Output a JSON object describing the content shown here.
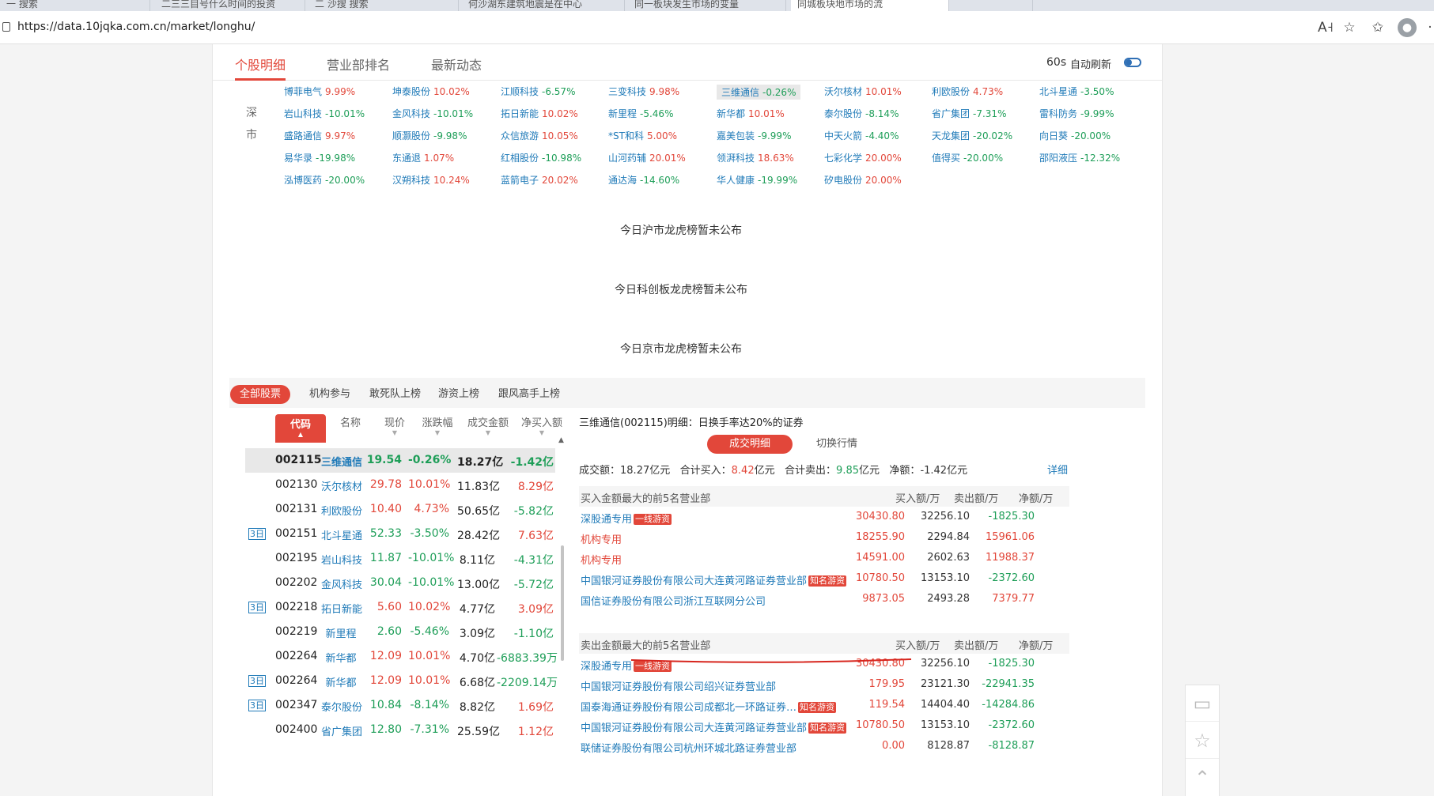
{
  "browser": {
    "tabs": [
      "一 搜索",
      "二三三目号什么时间的投资",
      "二 沙搜 搜索",
      "何沙湖东建筑地震是在中心",
      "同一板块发生市场的变量",
      "同城板块地市场的流",
      ""
    ],
    "url": "https://data.10jqka.com.cn/market/longhu/",
    "icons": [
      "read-aloud-icon",
      "favorite-icon",
      "collections-icon",
      "profile-icon",
      "more-icon"
    ]
  },
  "nav": {
    "tabs": [
      "个股明细",
      "营业部排名",
      "最新动态"
    ],
    "refresh_seconds": "60s",
    "refresh_label": "自动刷新"
  },
  "sz_market": {
    "label_top": "深",
    "label_bottom": "市",
    "stocks": [
      [
        "博菲电气",
        "9.99%",
        "up"
      ],
      [
        "坤泰股份",
        "10.02%",
        "up"
      ],
      [
        "江顺科技",
        "-6.57%",
        "down"
      ],
      [
        "三变科技",
        "9.98%",
        "up"
      ],
      [
        "三维通信",
        "-0.26%",
        "down"
      ],
      [
        "沃尔核材",
        "10.01%",
        "up"
      ],
      [
        "利欧股份",
        "4.73%",
        "up"
      ],
      [
        "北斗星通",
        "-3.50%",
        "down"
      ],
      [
        "岩山科技",
        "-10.01%",
        "down"
      ],
      [
        "金风科技",
        "-10.01%",
        "down"
      ],
      [
        "拓日新能",
        "10.02%",
        "up"
      ],
      [
        "新里程",
        "-5.46%",
        "down"
      ],
      [
        "新华都",
        "10.01%",
        "up"
      ],
      [
        "泰尔股份",
        "-8.14%",
        "down"
      ],
      [
        "省广集团",
        "-7.31%",
        "down"
      ],
      [
        "雷科防务",
        "-9.99%",
        "down"
      ],
      [
        "盛路通信",
        "9.97%",
        "up"
      ],
      [
        "顺灏股份",
        "-9.98%",
        "down"
      ],
      [
        "众信旅游",
        "10.05%",
        "up"
      ],
      [
        "*ST和科",
        "5.00%",
        "up"
      ],
      [
        "嘉美包装",
        "-9.99%",
        "down"
      ],
      [
        "中天火箭",
        "-4.40%",
        "down"
      ],
      [
        "天龙集团",
        "-20.02%",
        "down"
      ],
      [
        "向日葵",
        "-20.00%",
        "down"
      ],
      [
        "易华录",
        "-19.98%",
        "down"
      ],
      [
        "东通退",
        "1.07%",
        "up"
      ],
      [
        "红相股份",
        "-10.98%",
        "down"
      ],
      [
        "山河药辅",
        "20.01%",
        "up"
      ],
      [
        "领湃科技",
        "18.63%",
        "up"
      ],
      [
        "七彩化学",
        "20.00%",
        "up"
      ],
      [
        "值得买",
        "-20.00%",
        "down"
      ],
      [
        "邵阳液压",
        "-12.32%",
        "down"
      ],
      [
        "泓博医药",
        "-20.00%",
        "down"
      ],
      [
        "汉朔科技",
        "10.24%",
        "up"
      ],
      [
        "蓝箭电子",
        "20.02%",
        "up"
      ],
      [
        "通达海",
        "-14.60%",
        "down"
      ],
      [
        "华人健康",
        "-19.99%",
        "down"
      ],
      [
        "矽电股份",
        "20.00%",
        "up"
      ]
    ]
  },
  "notices": {
    "sh": "今日沪市龙虎榜暂未公布",
    "kcb": "今日科创板龙虎榜暂未公布",
    "bj": "今日京市龙虎榜暂未公布"
  },
  "filter_tabs": [
    "全部股票",
    "机构参与",
    "敢死队上榜",
    "游资上榜",
    "跟风高手上榜"
  ],
  "list": {
    "headers": [
      "代码",
      "名称",
      "现价",
      "涨跌幅",
      "成交金额",
      "净买入额"
    ],
    "rows": [
      {
        "badge": "",
        "code": "002115",
        "name": "三维通信",
        "price": "19.54",
        "chg": "-0.26%",
        "amt": "18.27亿",
        "net": "-1.42亿",
        "dir": "down",
        "ndir": "down"
      },
      {
        "badge": "",
        "code": "002130",
        "name": "沃尔核材",
        "price": "29.78",
        "chg": "10.01%",
        "amt": "11.83亿",
        "net": "8.29亿",
        "dir": "up",
        "ndir": "up"
      },
      {
        "badge": "",
        "code": "002131",
        "name": "利欧股份",
        "price": "10.40",
        "chg": "4.73%",
        "amt": "50.65亿",
        "net": "-5.82亿",
        "dir": "up",
        "ndir": "down"
      },
      {
        "badge": "3日",
        "code": "002151",
        "name": "北斗星通",
        "price": "52.33",
        "chg": "-3.50%",
        "amt": "28.42亿",
        "net": "7.63亿",
        "dir": "down",
        "ndir": "up"
      },
      {
        "badge": "",
        "code": "002195",
        "name": "岩山科技",
        "price": "11.87",
        "chg": "-10.01%",
        "amt": "8.11亿",
        "net": "-4.31亿",
        "dir": "down",
        "ndir": "down"
      },
      {
        "badge": "",
        "code": "002202",
        "name": "金风科技",
        "price": "30.04",
        "chg": "-10.01%",
        "amt": "13.00亿",
        "net": "-5.72亿",
        "dir": "down",
        "ndir": "down"
      },
      {
        "badge": "3日",
        "code": "002218",
        "name": "拓日新能",
        "price": "5.60",
        "chg": "10.02%",
        "amt": "4.77亿",
        "net": "3.09亿",
        "dir": "up",
        "ndir": "up"
      },
      {
        "badge": "",
        "code": "002219",
        "name": "新里程",
        "price": "2.60",
        "chg": "-5.46%",
        "amt": "3.09亿",
        "net": "-1.10亿",
        "dir": "down",
        "ndir": "down"
      },
      {
        "badge": "",
        "code": "002264",
        "name": "新华都",
        "price": "12.09",
        "chg": "10.01%",
        "amt": "4.70亿",
        "net": "-6883.39万",
        "dir": "up",
        "ndir": "down"
      },
      {
        "badge": "3日",
        "code": "002264",
        "name": "新华都",
        "price": "12.09",
        "chg": "10.01%",
        "amt": "6.68亿",
        "net": "-2209.14万",
        "dir": "up",
        "ndir": "down"
      },
      {
        "badge": "3日",
        "code": "002347",
        "name": "泰尔股份",
        "price": "10.84",
        "chg": "-8.14%",
        "amt": "8.82亿",
        "net": "1.69亿",
        "dir": "down",
        "ndir": "up"
      },
      {
        "badge": "",
        "code": "002400",
        "name": "省广集团",
        "price": "12.80",
        "chg": "-7.31%",
        "amt": "25.59亿",
        "net": "1.12亿",
        "dir": "down",
        "ndir": "up"
      }
    ]
  },
  "detail": {
    "title": "三维通信(002115)明细：日换手率达20%的证券",
    "btn_deals": "成交明细",
    "btn_switch": "切换行情",
    "sum_amt_label": "成交额：",
    "sum_amt": "18.27亿元",
    "sum_buy_label": "合计买入：",
    "sum_buy": "8.42",
    "sum_sell_label": "合计卖出：",
    "sum_sell": "9.85",
    "unit_yi": "亿元",
    "sum_net_label": "净额：",
    "sum_net": "-1.42亿元",
    "detail_link": "详细",
    "buy_header": "买入金额最大的前5名营业部",
    "sell_header": "卖出金额最大的前5名营业部",
    "col_buy": "买入额/万",
    "col_sell": "卖出额/万",
    "col_net": "净额/万",
    "buy_rows": [
      {
        "name": "深股通专用",
        "tag": "一线游资",
        "buy": "30430.80",
        "sell": "32256.10",
        "net": "-1825.30",
        "nc": "grn",
        "red": false
      },
      {
        "name": "机构专用",
        "tag": "",
        "buy": "18255.90",
        "sell": "2294.84",
        "net": "15961.06",
        "nc": "red",
        "red": true
      },
      {
        "name": "机构专用",
        "tag": "",
        "buy": "14591.00",
        "sell": "2602.63",
        "net": "11988.37",
        "nc": "red",
        "red": true
      },
      {
        "name": "中国银河证券股份有限公司大连黄河路证券营业部",
        "tag": "知名游资",
        "buy": "10780.50",
        "sell": "13153.10",
        "net": "-2372.60",
        "nc": "grn",
        "red": false
      },
      {
        "name": "国信证券股份有限公司浙江互联网分公司",
        "tag": "",
        "buy": "9873.05",
        "sell": "2493.28",
        "net": "7379.77",
        "nc": "red",
        "red": false
      }
    ],
    "sell_rows": [
      {
        "name": "深股通专用",
        "tag": "一线游资",
        "buy": "30430.80",
        "sell": "32256.10",
        "net": "-1825.30",
        "nc": "grn",
        "red": false
      },
      {
        "name": "中国银河证券股份有限公司绍兴证券营业部",
        "tag": "",
        "buy": "179.95",
        "sell": "23121.30",
        "net": "-22941.35",
        "nc": "grn",
        "red": false
      },
      {
        "name": "国泰海通证券股份有限公司成都北一环路证券…",
        "tag": "知名游资",
        "buy": "119.54",
        "sell": "14404.40",
        "net": "-14284.86",
        "nc": "grn",
        "red": false
      },
      {
        "name": "中国银河证券股份有限公司大连黄河路证券营业部",
        "tag": "知名游资",
        "buy": "10780.50",
        "sell": "13153.10",
        "net": "-2372.60",
        "nc": "grn",
        "red": false
      },
      {
        "name": "联储证券股份有限公司杭州环城北路证券营业部",
        "tag": "",
        "buy": "0.00",
        "sell": "8128.87",
        "net": "-8128.87",
        "nc": "grn",
        "red": false
      }
    ]
  },
  "float_icons": [
    "feedback-icon",
    "star-icon",
    "back-to-top-icon"
  ]
}
